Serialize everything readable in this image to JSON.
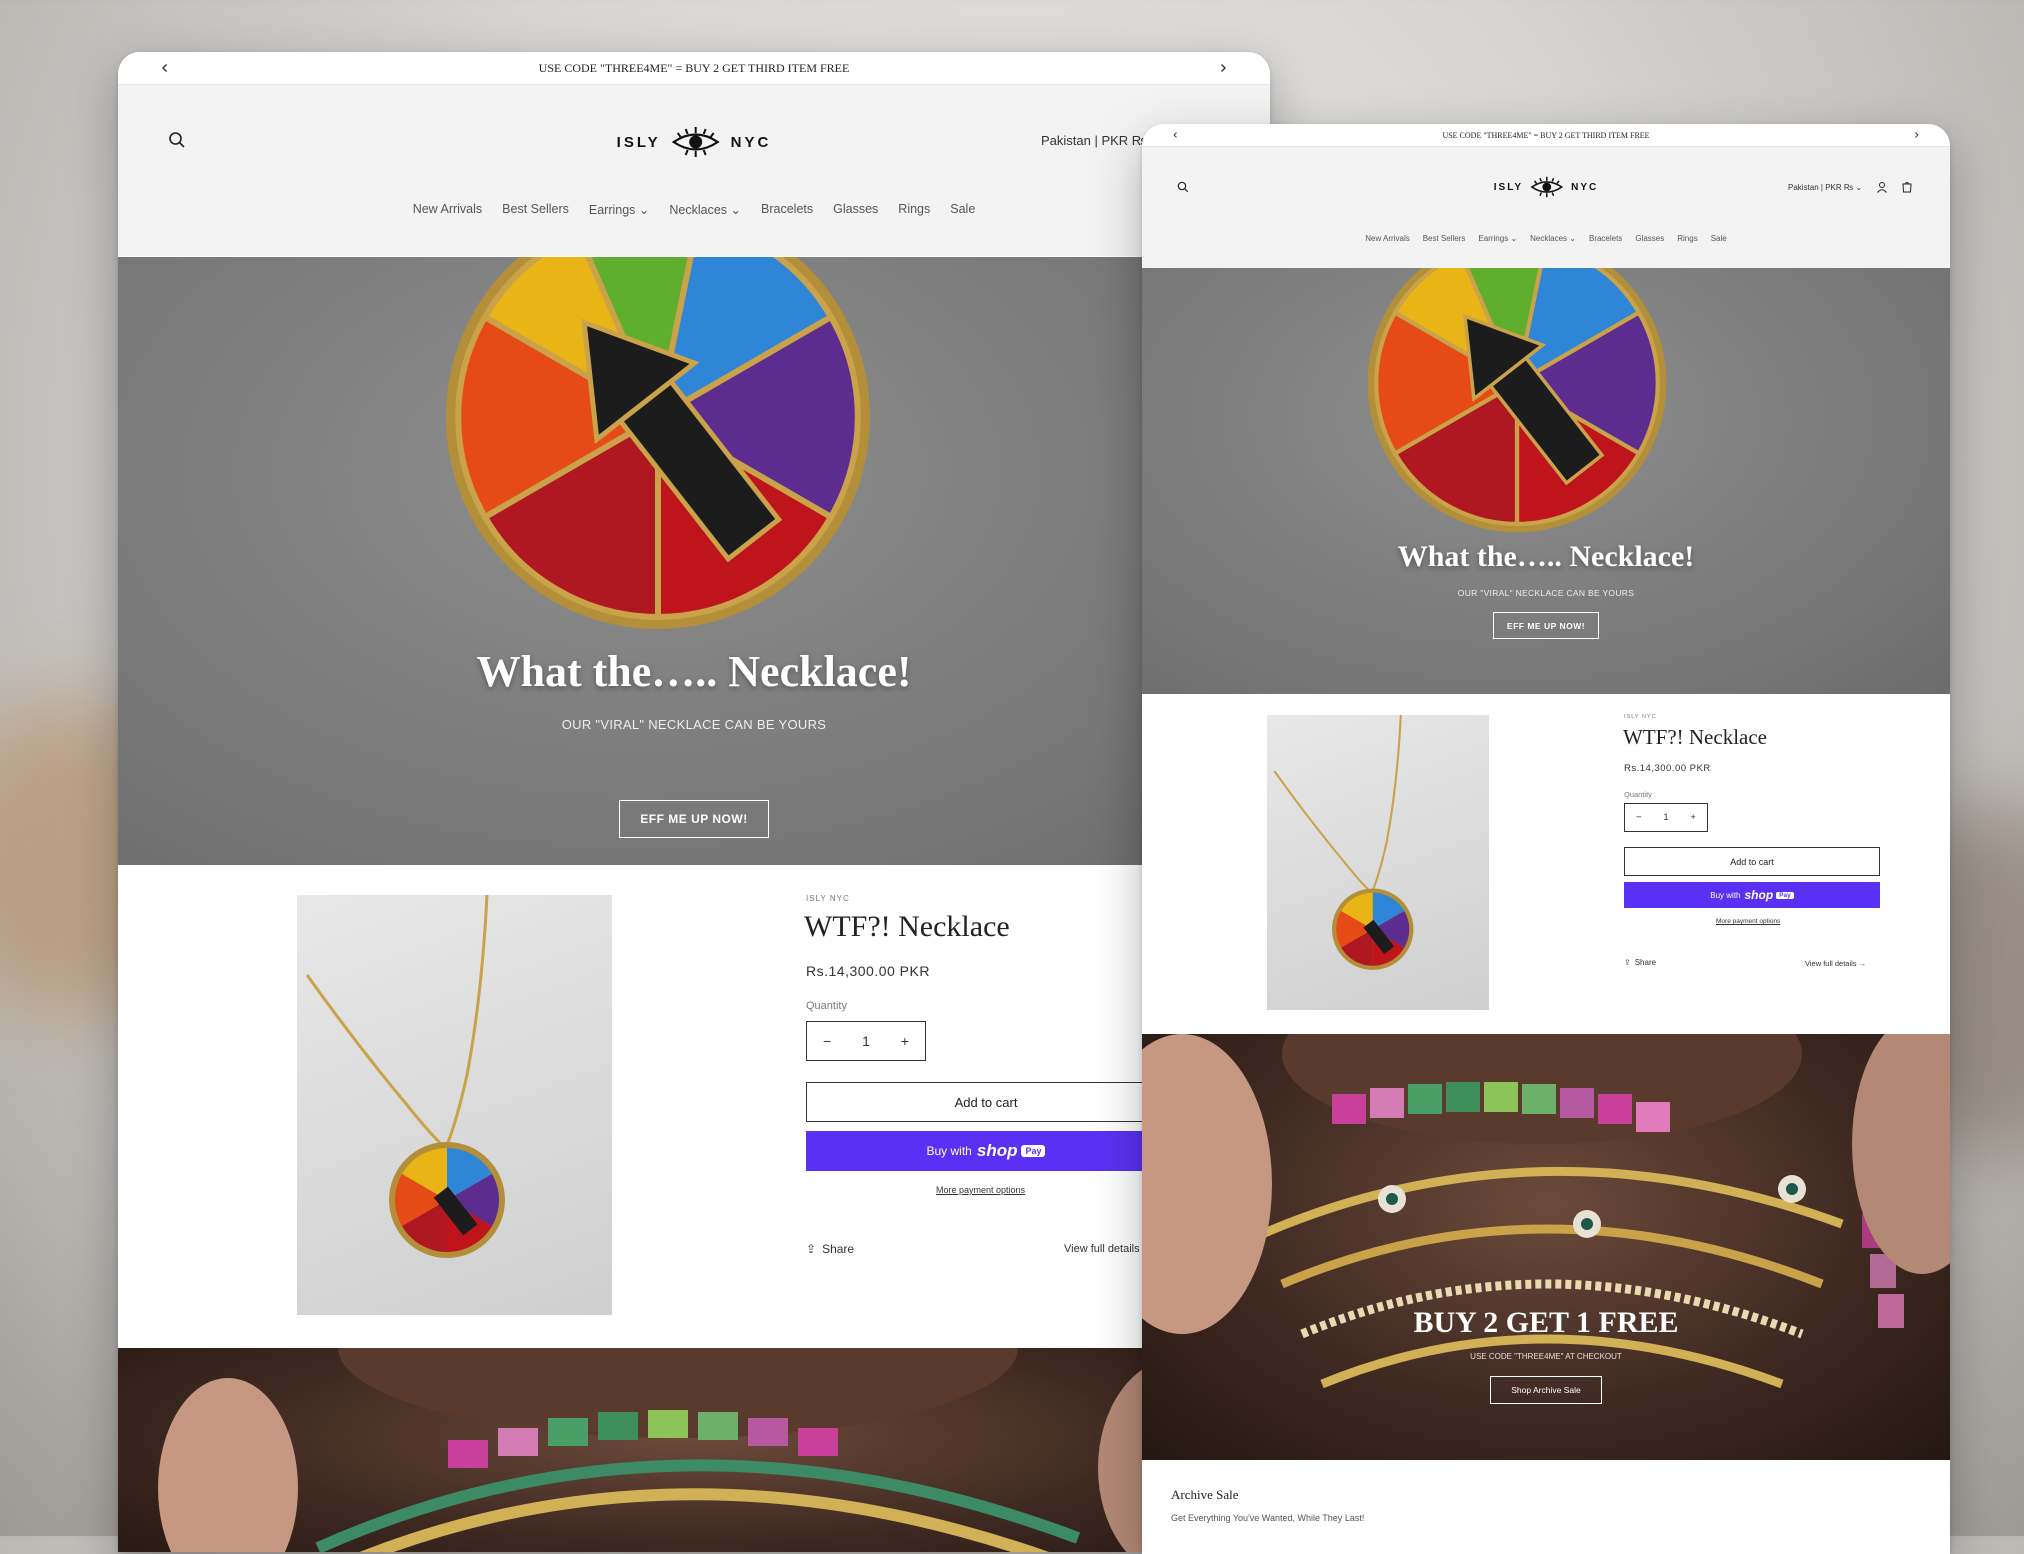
{
  "colors": {
    "shop_pay": "#5a31f4",
    "header_bg": "#f3f3f3",
    "hero_bg": "#7c7c7c"
  },
  "desktop": {
    "announcement": "USE CODE \"THREE4ME\" = BUY 2 GET THIRD ITEM FREE",
    "logo_left": "ISLY",
    "logo_right": "NYC",
    "country": "Pakistan | PKR ₨",
    "nav": [
      "New Arrivals",
      "Best Sellers",
      "Earrings",
      "Necklaces",
      "Bracelets",
      "Glasses",
      "Rings",
      "Sale"
    ],
    "hero": {
      "title": "What the….. Necklace!",
      "subtitle": "OUR \"VIRAL\" NECKLACE CAN BE YOURS",
      "button": "EFF ME UP NOW!"
    },
    "product": {
      "vendor": "ISLY NYC",
      "title": "WTF?! Necklace",
      "price": "Rs.14,300.00 PKR",
      "quantity_label": "Quantity",
      "quantity": "1",
      "add_to_cart": "Add to cart",
      "buy_with": "Buy with",
      "shop": "shop",
      "pay": "Pay",
      "more_payment": "More payment options",
      "share": "Share",
      "view_full": "View full details"
    }
  },
  "mobile": {
    "announcement": "USE CODE \"THREE4ME\" = BUY 2 GET THIRD ITEM FREE",
    "logo_left": "ISLY",
    "logo_right": "NYC",
    "country": "Pakistan | PKR ₨",
    "nav": [
      "New Arrivals",
      "Best Sellers",
      "Earrings",
      "Necklaces",
      "Bracelets",
      "Glasses",
      "Rings",
      "Sale"
    ],
    "hero": {
      "title": "What the….. Necklace!",
      "subtitle": "OUR \"VIRAL\" NECKLACE CAN BE YOURS",
      "button": "EFF ME UP NOW!"
    },
    "product": {
      "vendor": "ISLY NYC",
      "title": "WTF?! Necklace",
      "price": "Rs.14,300.00 PKR",
      "quantity_label": "Quantity",
      "quantity": "1",
      "add_to_cart": "Add to cart",
      "buy_with": "Buy with",
      "shop": "shop",
      "pay": "Pay",
      "more_payment": "More payment options",
      "share": "Share",
      "view_full": "View full details"
    },
    "promo": {
      "title": "BUY 2 GET 1 FREE",
      "subtitle": "USE CODE \"THREE4ME\" AT CHECKOUT",
      "button": "Shop Archive Sale"
    },
    "archive": {
      "title": "Archive Sale",
      "subtitle": "Get Everything You've Wanted, While They Last!"
    }
  }
}
